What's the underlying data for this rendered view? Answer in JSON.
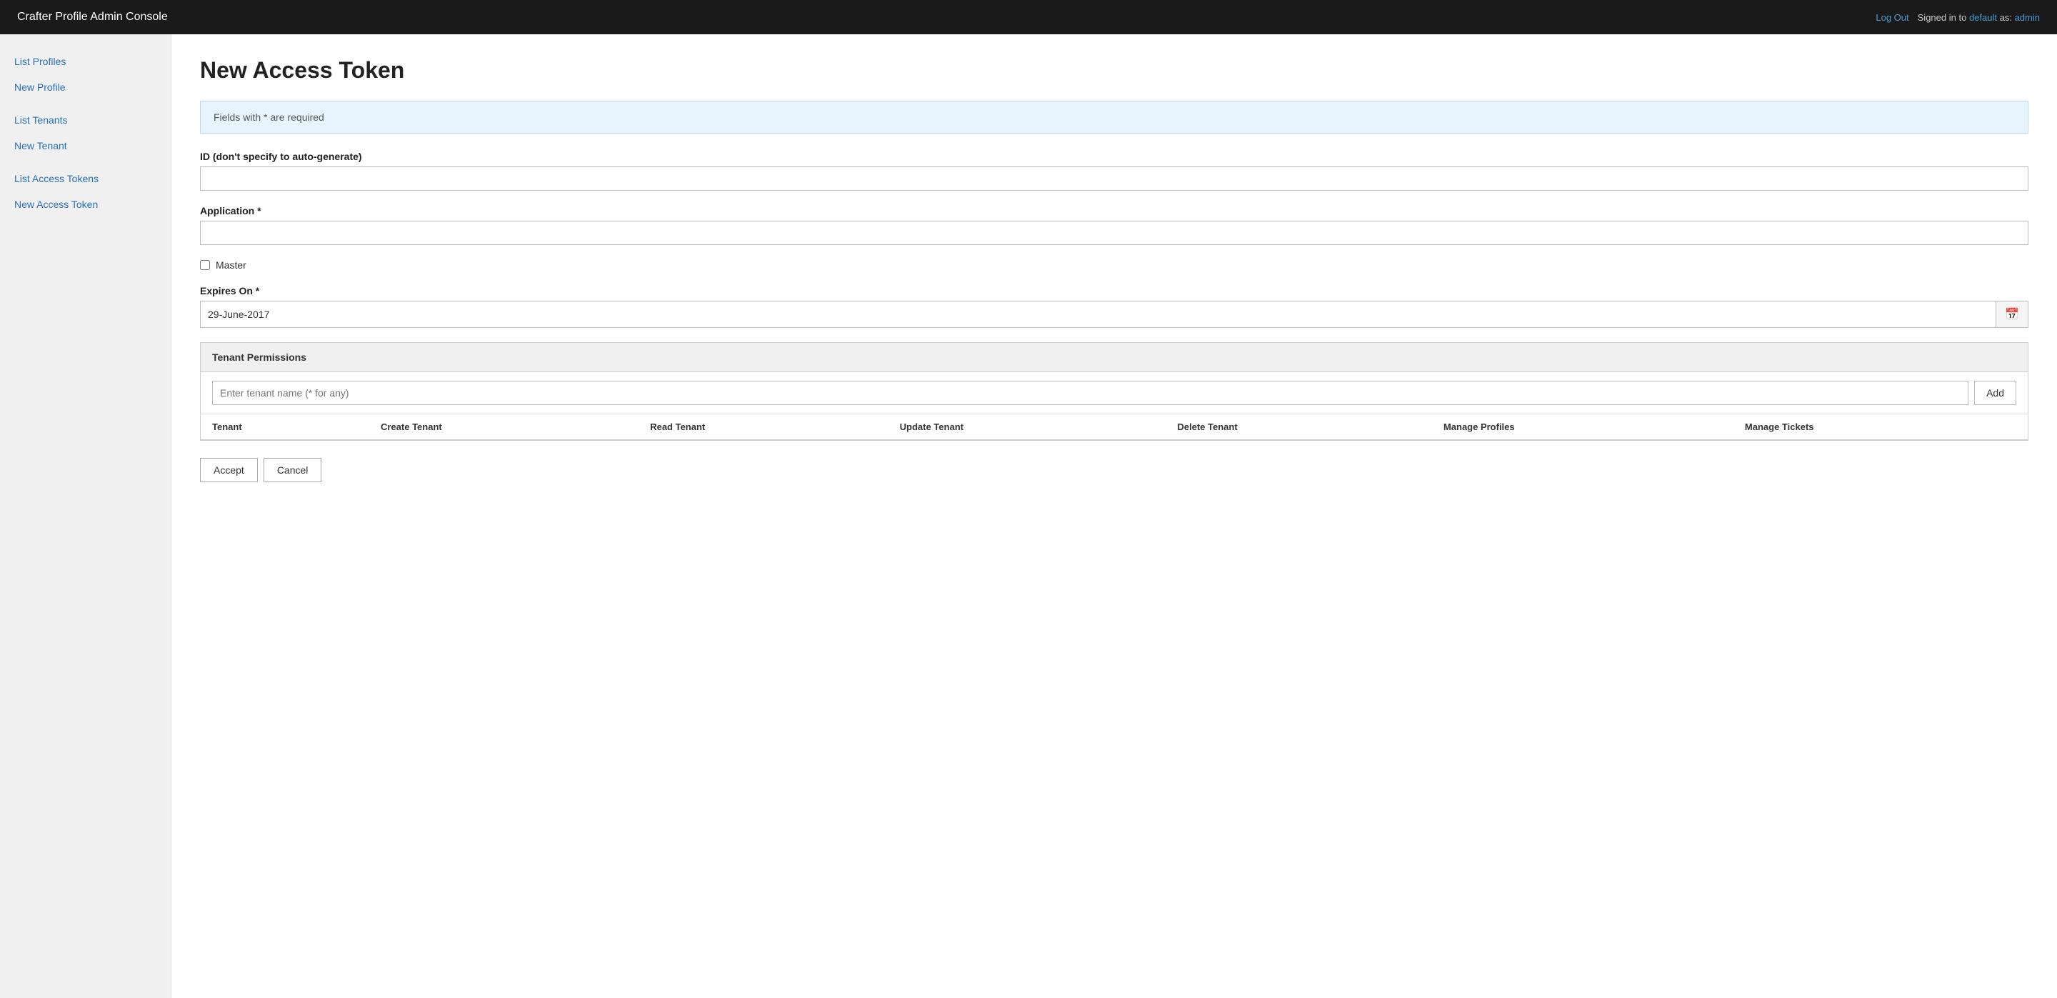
{
  "header": {
    "title": "Crafter Profile Admin Console",
    "logout_label": "Log Out",
    "signed_in_text": "Signed in to",
    "tenant_link": "default",
    "as_text": "as:",
    "user_link": "admin"
  },
  "sidebar": {
    "items": [
      {
        "id": "list-profiles",
        "label": "List Profiles"
      },
      {
        "id": "new-profile",
        "label": "New Profile"
      },
      {
        "id": "list-tenants",
        "label": "List Tenants"
      },
      {
        "id": "new-tenant",
        "label": "New Tenant"
      },
      {
        "id": "list-access-tokens",
        "label": "List Access Tokens"
      },
      {
        "id": "new-access-token",
        "label": "New Access Token"
      }
    ]
  },
  "main": {
    "page_title": "New Access Token",
    "info_message": "Fields with * are required",
    "form": {
      "id_label": "ID (don't specify to auto-generate)",
      "id_placeholder": "",
      "application_label": "Application *",
      "application_placeholder": "",
      "master_label": "Master",
      "expires_on_label": "Expires On *",
      "expires_on_value": "29-June-2017",
      "calendar_icon": "📅"
    },
    "tenant_permissions": {
      "section_title": "Tenant Permissions",
      "tenant_input_placeholder": "Enter tenant name (* for any)",
      "add_button_label": "Add",
      "table_columns": [
        "Tenant",
        "Create Tenant",
        "Read Tenant",
        "Update Tenant",
        "Delete Tenant",
        "Manage Profiles",
        "Manage Tickets"
      ]
    },
    "actions": {
      "accept_label": "Accept",
      "cancel_label": "Cancel"
    }
  }
}
